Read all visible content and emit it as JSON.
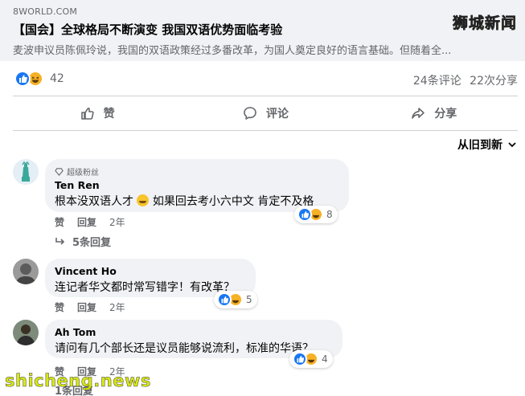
{
  "link_preview": {
    "source": "8WORLD.COM",
    "headline": "【国会】全球格局不断演变 我国双语优势面临考验",
    "description": "麦波申议员陈佩玲说，我国的双语政策经过多番改革，为国人奠定良好的语言基础。但随着全...",
    "watermark": "狮城新闻"
  },
  "stats": {
    "reaction_count": "42",
    "comments": "24条评论",
    "shares": "22次分享",
    "reaction_icons": [
      "like-icon",
      "haha-icon"
    ]
  },
  "actions": {
    "like": "赞",
    "comment": "评论",
    "share": "分享"
  },
  "sort_label": "从旧到新",
  "comments": [
    {
      "badge": "超级粉丝",
      "name": "Ten Ren",
      "text_before": "根本没双语人才",
      "text_after": "如果回去考小六中文 肯定不及格",
      "reaction_count": "8",
      "like_label": "赞",
      "reply_label": "回复",
      "time": "2年",
      "replies": "5条回复"
    },
    {
      "name": "Vincent Ho",
      "text": "连记者华文都时常写错字！有改革？",
      "reaction_count": "5",
      "like_label": "赞",
      "reply_label": "回复",
      "time": "2年"
    },
    {
      "name": "Ah Tom",
      "text": "请问有几个部长还是议员能够说流利，标准的华语？",
      "reaction_count": "4",
      "like_label": "赞",
      "reply_label": "回复",
      "time": "2年",
      "replies": "1条回复"
    }
  ],
  "site_watermark": "shicheng.news",
  "colors": {
    "like_blue": "#1877f2",
    "haha_yellow": "#f7b125",
    "bubble_bg": "#f0f2f5",
    "muted_text": "#65676b"
  }
}
